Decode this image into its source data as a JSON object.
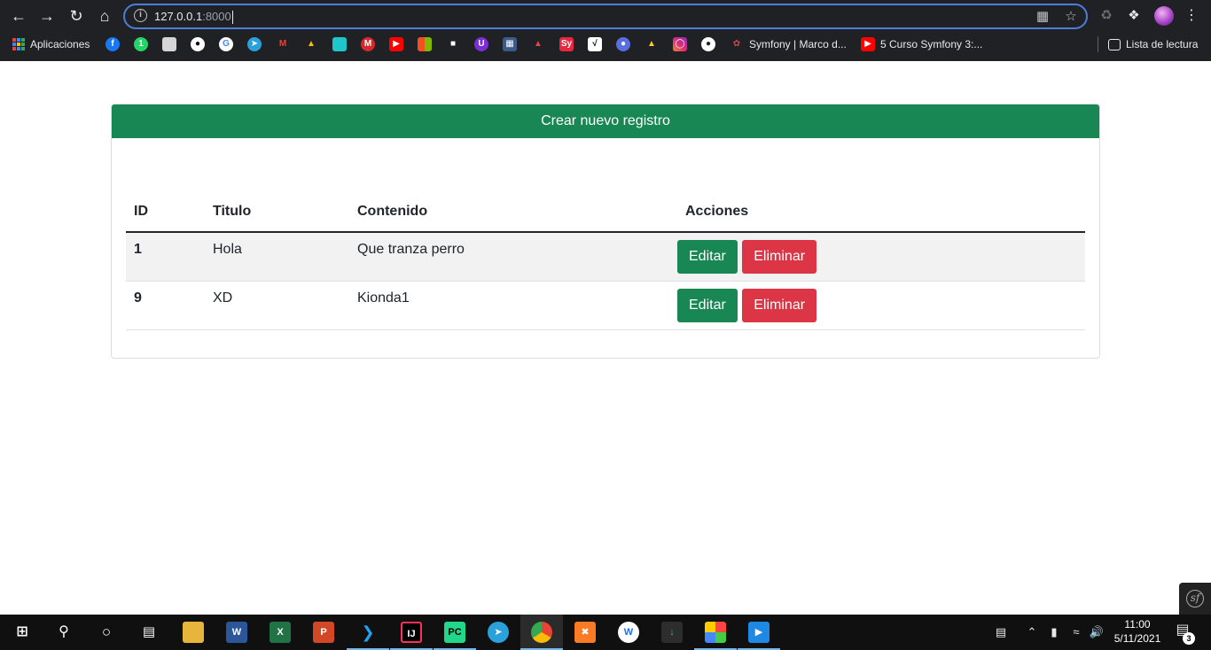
{
  "browser": {
    "url_host": "127.0.0.1",
    "url_port": ":8000",
    "bookmarks": [
      {
        "label": "Aplicaciones",
        "icon": "apps-grid-icon"
      },
      {
        "label": "Symfony | Marco d...",
        "icon": "symfony-icon"
      },
      {
        "label": "5 Curso Symfony 3:...",
        "icon": "youtube-icon"
      }
    ],
    "reading_list": "Lista de lectura"
  },
  "page": {
    "create_button": "Crear nuevo registro",
    "table": {
      "headers": [
        "ID",
        "Titulo",
        "Contenido",
        "Acciones"
      ],
      "rows": [
        {
          "id": "1",
          "titulo": "Hola",
          "contenido": "Que tranza perro",
          "edit": "Editar",
          "delete": "Eliminar"
        },
        {
          "id": "9",
          "titulo": "XD",
          "contenido": "Kionda1",
          "edit": "Editar",
          "delete": "Eliminar"
        }
      ]
    }
  },
  "taskbar": {
    "time": "11:00",
    "date": "5/11/2021",
    "notifications": "3"
  },
  "colors": {
    "success": "#198754",
    "danger": "#dc3545",
    "chrome_bg": "#202124"
  }
}
